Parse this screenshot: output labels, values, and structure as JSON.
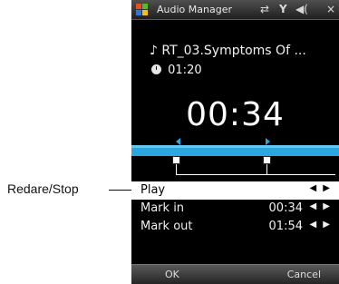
{
  "callout": {
    "label": "Redare/Stop"
  },
  "titlebar": {
    "title": "Audio Manager",
    "icons": [
      "sync-icon",
      "signal-icon",
      "speaker-icon"
    ],
    "icon_glyphs": {
      "sync": "⇄",
      "signal": "Y",
      "speaker": "◀("
    },
    "close": "×"
  },
  "now_playing": {
    "track": "RT_03.Symptoms Of ...",
    "duration": "01:20",
    "elapsed": "00:34"
  },
  "menu": {
    "items": [
      {
        "label": "Play",
        "value": "",
        "arrows": "◀ ▶"
      },
      {
        "label": "Mark in",
        "value": "00:34",
        "arrows": "◀ ▶"
      },
      {
        "label": "Mark out",
        "value": "01:54",
        "arrows": "◀ ▶"
      }
    ]
  },
  "softkeys": {
    "left": "OK",
    "right": "Cancel"
  },
  "colors": {
    "slider": "#2aa6e0",
    "selection": "#ffffff",
    "background": "#000000"
  }
}
